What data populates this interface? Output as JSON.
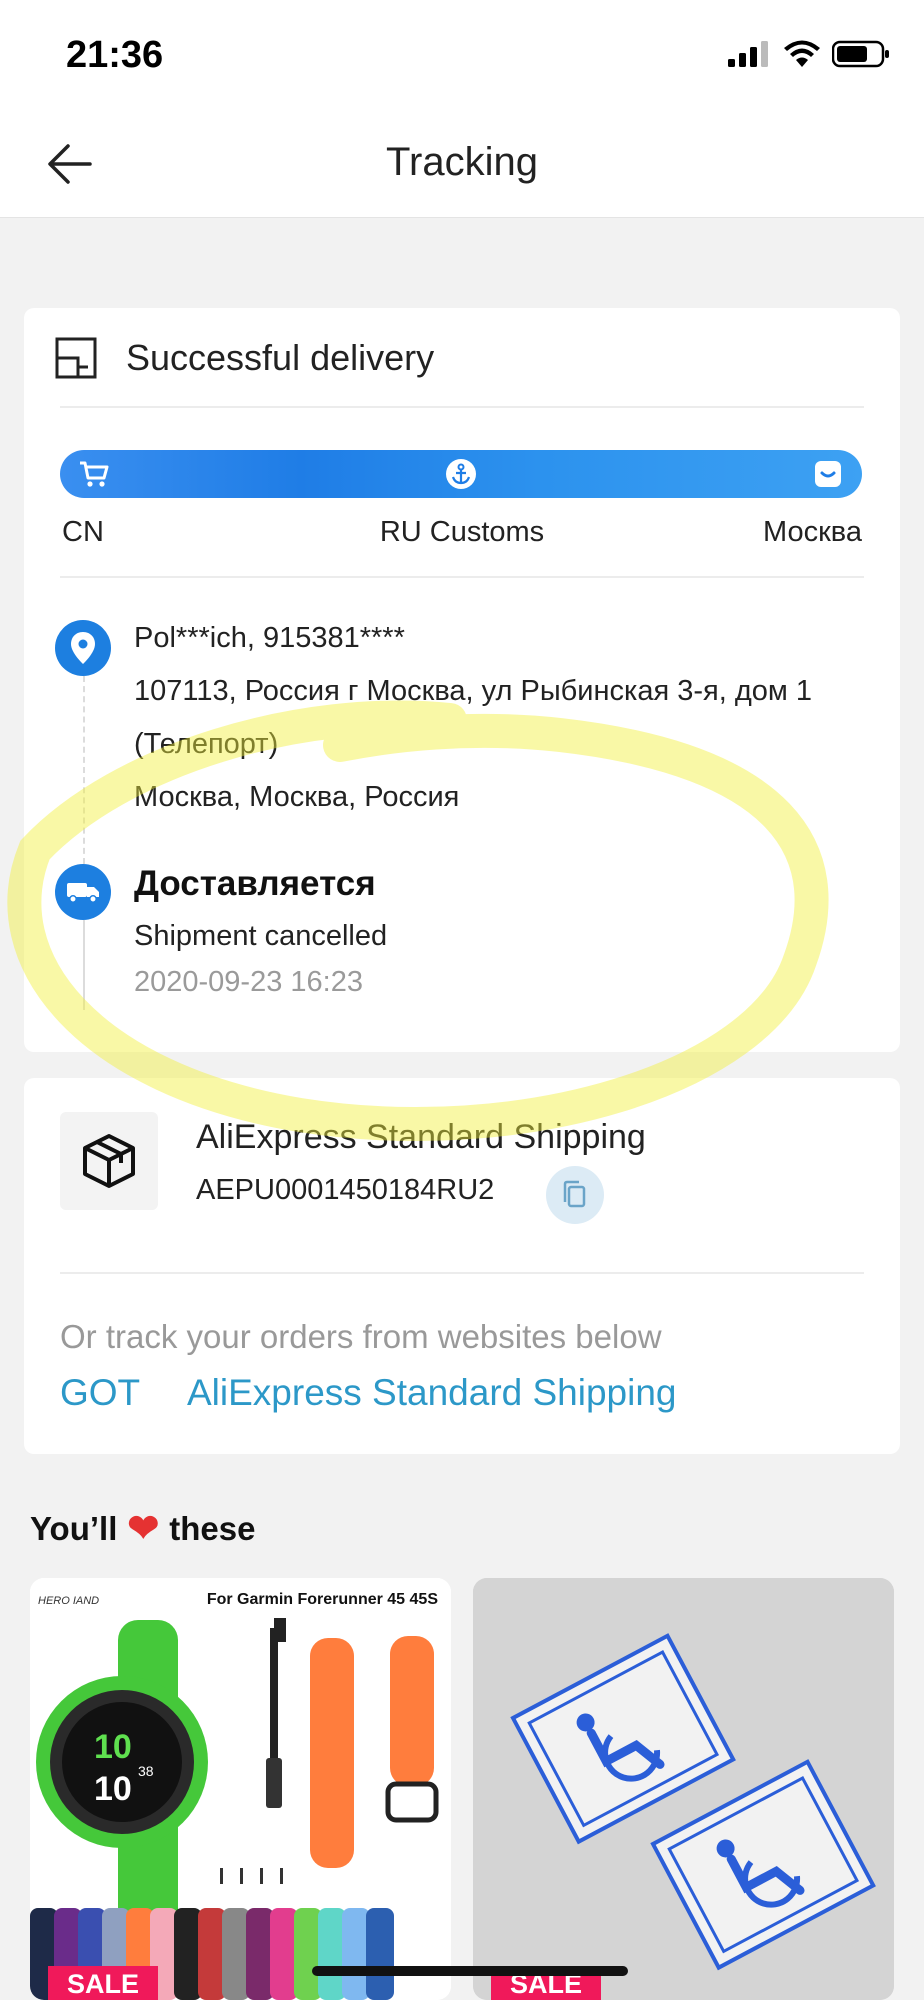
{
  "status_bar": {
    "time": "21:36"
  },
  "header": {
    "title": "Tracking"
  },
  "delivery": {
    "status": "Successful delivery",
    "stages": [
      "CN",
      "RU Customs",
      "Москва"
    ],
    "recipient": "Pol***ich, 915381****",
    "address_line1": "107113, Россия г Москва, ул Рыбинская 3-я, дом 1",
    "address_line2": "(Телепорт)",
    "address_line3": "Москва, Москва, Россия",
    "event_title": "Доставляется",
    "event_desc": "Shipment cancelled",
    "event_time": "2020-09-23 16:23"
  },
  "shipping": {
    "carrier": "AliExpress Standard Shipping",
    "tracking_number": "AEPU0001450184RU2",
    "alt_prompt": "Or track your orders from websites below",
    "links": [
      "GOT",
      "AliExpress Standard Shipping"
    ]
  },
  "recommend": {
    "heading_before": "You’ll",
    "heading_after": "these",
    "products": [
      {
        "brand": "HERO IAND",
        "caption": "For Garmin Forerunner 45 45S",
        "watch_top": "10",
        "watch_bottom": "10",
        "watch_side": "38",
        "badge": "SALE"
      },
      {
        "badge": "SALE"
      }
    ]
  },
  "colors": {
    "accent_blue": "#1d7fe0",
    "link": "#2c98c8",
    "sale": "#f0195a"
  }
}
